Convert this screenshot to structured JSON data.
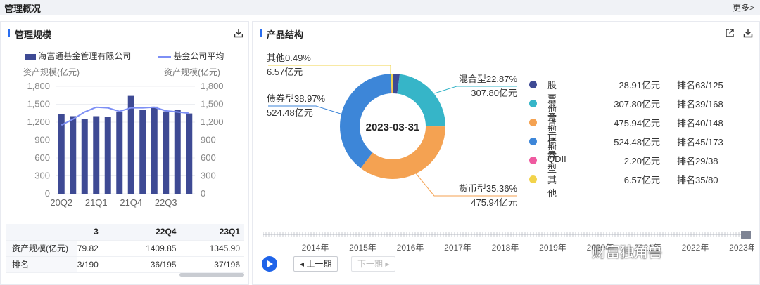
{
  "header": {
    "title": "管理概况",
    "more": "更多>"
  },
  "left_panel": {
    "title": "管理规模",
    "legend_bar": "海富通基金管理有限公司",
    "legend_line": "基金公司平均",
    "left_axis_label": "资产规模(亿元)",
    "right_axis_label": "资产规模(亿元)",
    "table": {
      "headers": [
        "",
        "3",
        "22Q4",
        "23Q1"
      ],
      "rows": [
        [
          "资产规模(亿元)",
          "79.82",
          "1409.85",
          "1345.90"
        ],
        [
          "排名",
          "3/190",
          "36/195",
          "37/196"
        ]
      ]
    }
  },
  "right_panel": {
    "title": "产品结构",
    "center_label": "2023-03-31",
    "callouts": {
      "other_pct": "其他0.49%",
      "other_amt": "6.57亿元",
      "mixed_pct": "混合型22.87%",
      "mixed_amt": "307.80亿元",
      "bond_pct": "债券型38.97%",
      "bond_amt": "524.48亿元",
      "money_pct": "货币型35.36%",
      "money_amt": "475.94亿元"
    },
    "legend": [
      {
        "name": "股票型",
        "value": "28.91亿元",
        "rank": "排名63/125",
        "color": "#3e4a94"
      },
      {
        "name": "混合型",
        "value": "307.80亿元",
        "rank": "排名39/168",
        "color": "#36b5c8"
      },
      {
        "name": "货币型",
        "value": "475.94亿元",
        "rank": "排名40/148",
        "color": "#f4a252"
      },
      {
        "name": "债券型",
        "value": "524.48亿元",
        "rank": "排名45/173",
        "color": "#3d86d8"
      },
      {
        "name": "QDII",
        "value": "2.20亿元",
        "rank": "排名29/38",
        "color": "#ef5aa0"
      },
      {
        "name": "其他",
        "value": "6.57亿元",
        "rank": "排名35/80",
        "color": "#f2d34a"
      }
    ],
    "timeline_years": [
      "2014年",
      "2015年",
      "2016年",
      "2017年",
      "2018年",
      "2019年",
      "2020年",
      "2021年",
      "2022年",
      "2023年"
    ],
    "prev_button": "上一期",
    "next_button": "下一期",
    "watermark": "财富独角兽"
  },
  "chart_data": [
    {
      "type": "bar",
      "categories": [
        "20Q2",
        "20Q3",
        "20Q4",
        "21Q1",
        "21Q2",
        "21Q3",
        "21Q4",
        "22Q1",
        "22Q2",
        "22Q3",
        "22Q4",
        "23Q1"
      ],
      "xticks": [
        "20Q2",
        "21Q1",
        "21Q4",
        "22Q3"
      ],
      "series": [
        {
          "name": "海富通基金管理有限公司",
          "type": "bar",
          "color": "#3e4a94",
          "values": [
            1330,
            1300,
            1250,
            1300,
            1290,
            1370,
            1640,
            1410,
            1460,
            1380,
            1409.85,
            1345.9
          ]
        },
        {
          "name": "基金公司平均",
          "type": "line",
          "color": "#7d8ff5",
          "values": [
            1150,
            1250,
            1370,
            1450,
            1440,
            1380,
            1440,
            1440,
            1450,
            1390,
            1370,
            1350
          ]
        }
      ],
      "yticks": [
        "0",
        "300",
        "600",
        "900",
        "1,200",
        "1,500",
        "1,800"
      ],
      "ylim": [
        0,
        1800
      ]
    },
    {
      "type": "pie",
      "labels": [
        "股票型",
        "混合型",
        "货币型",
        "债券型",
        "QDII",
        "其他"
      ],
      "values": [
        28.91,
        307.8,
        475.94,
        524.48,
        2.2,
        6.57
      ],
      "colors": [
        "#3e4a94",
        "#36b5c8",
        "#f4a252",
        "#3d86d8",
        "#ef5aa0",
        "#f2d34a"
      ]
    }
  ]
}
